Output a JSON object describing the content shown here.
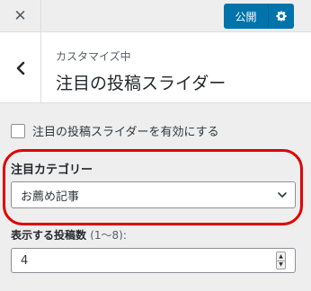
{
  "topbar": {
    "close_icon": "close-icon",
    "publish_label": "公開",
    "gear_icon": "gear-icon"
  },
  "header": {
    "back_icon": "chevron-left-icon",
    "subtitle": "カスタマイズ中",
    "title": "注目の投稿スライダー"
  },
  "settings": {
    "enable_label": "注目の投稿スライダーを有効にする",
    "enable_checked": false,
    "category_label": "注目カテゴリー",
    "category_selected": "お薦め記事",
    "count_label": "表示する投稿数",
    "count_range": "(1〜8):",
    "count_value": "4"
  },
  "colors": {
    "accent": "#0073aa",
    "highlight": "#e00000"
  }
}
